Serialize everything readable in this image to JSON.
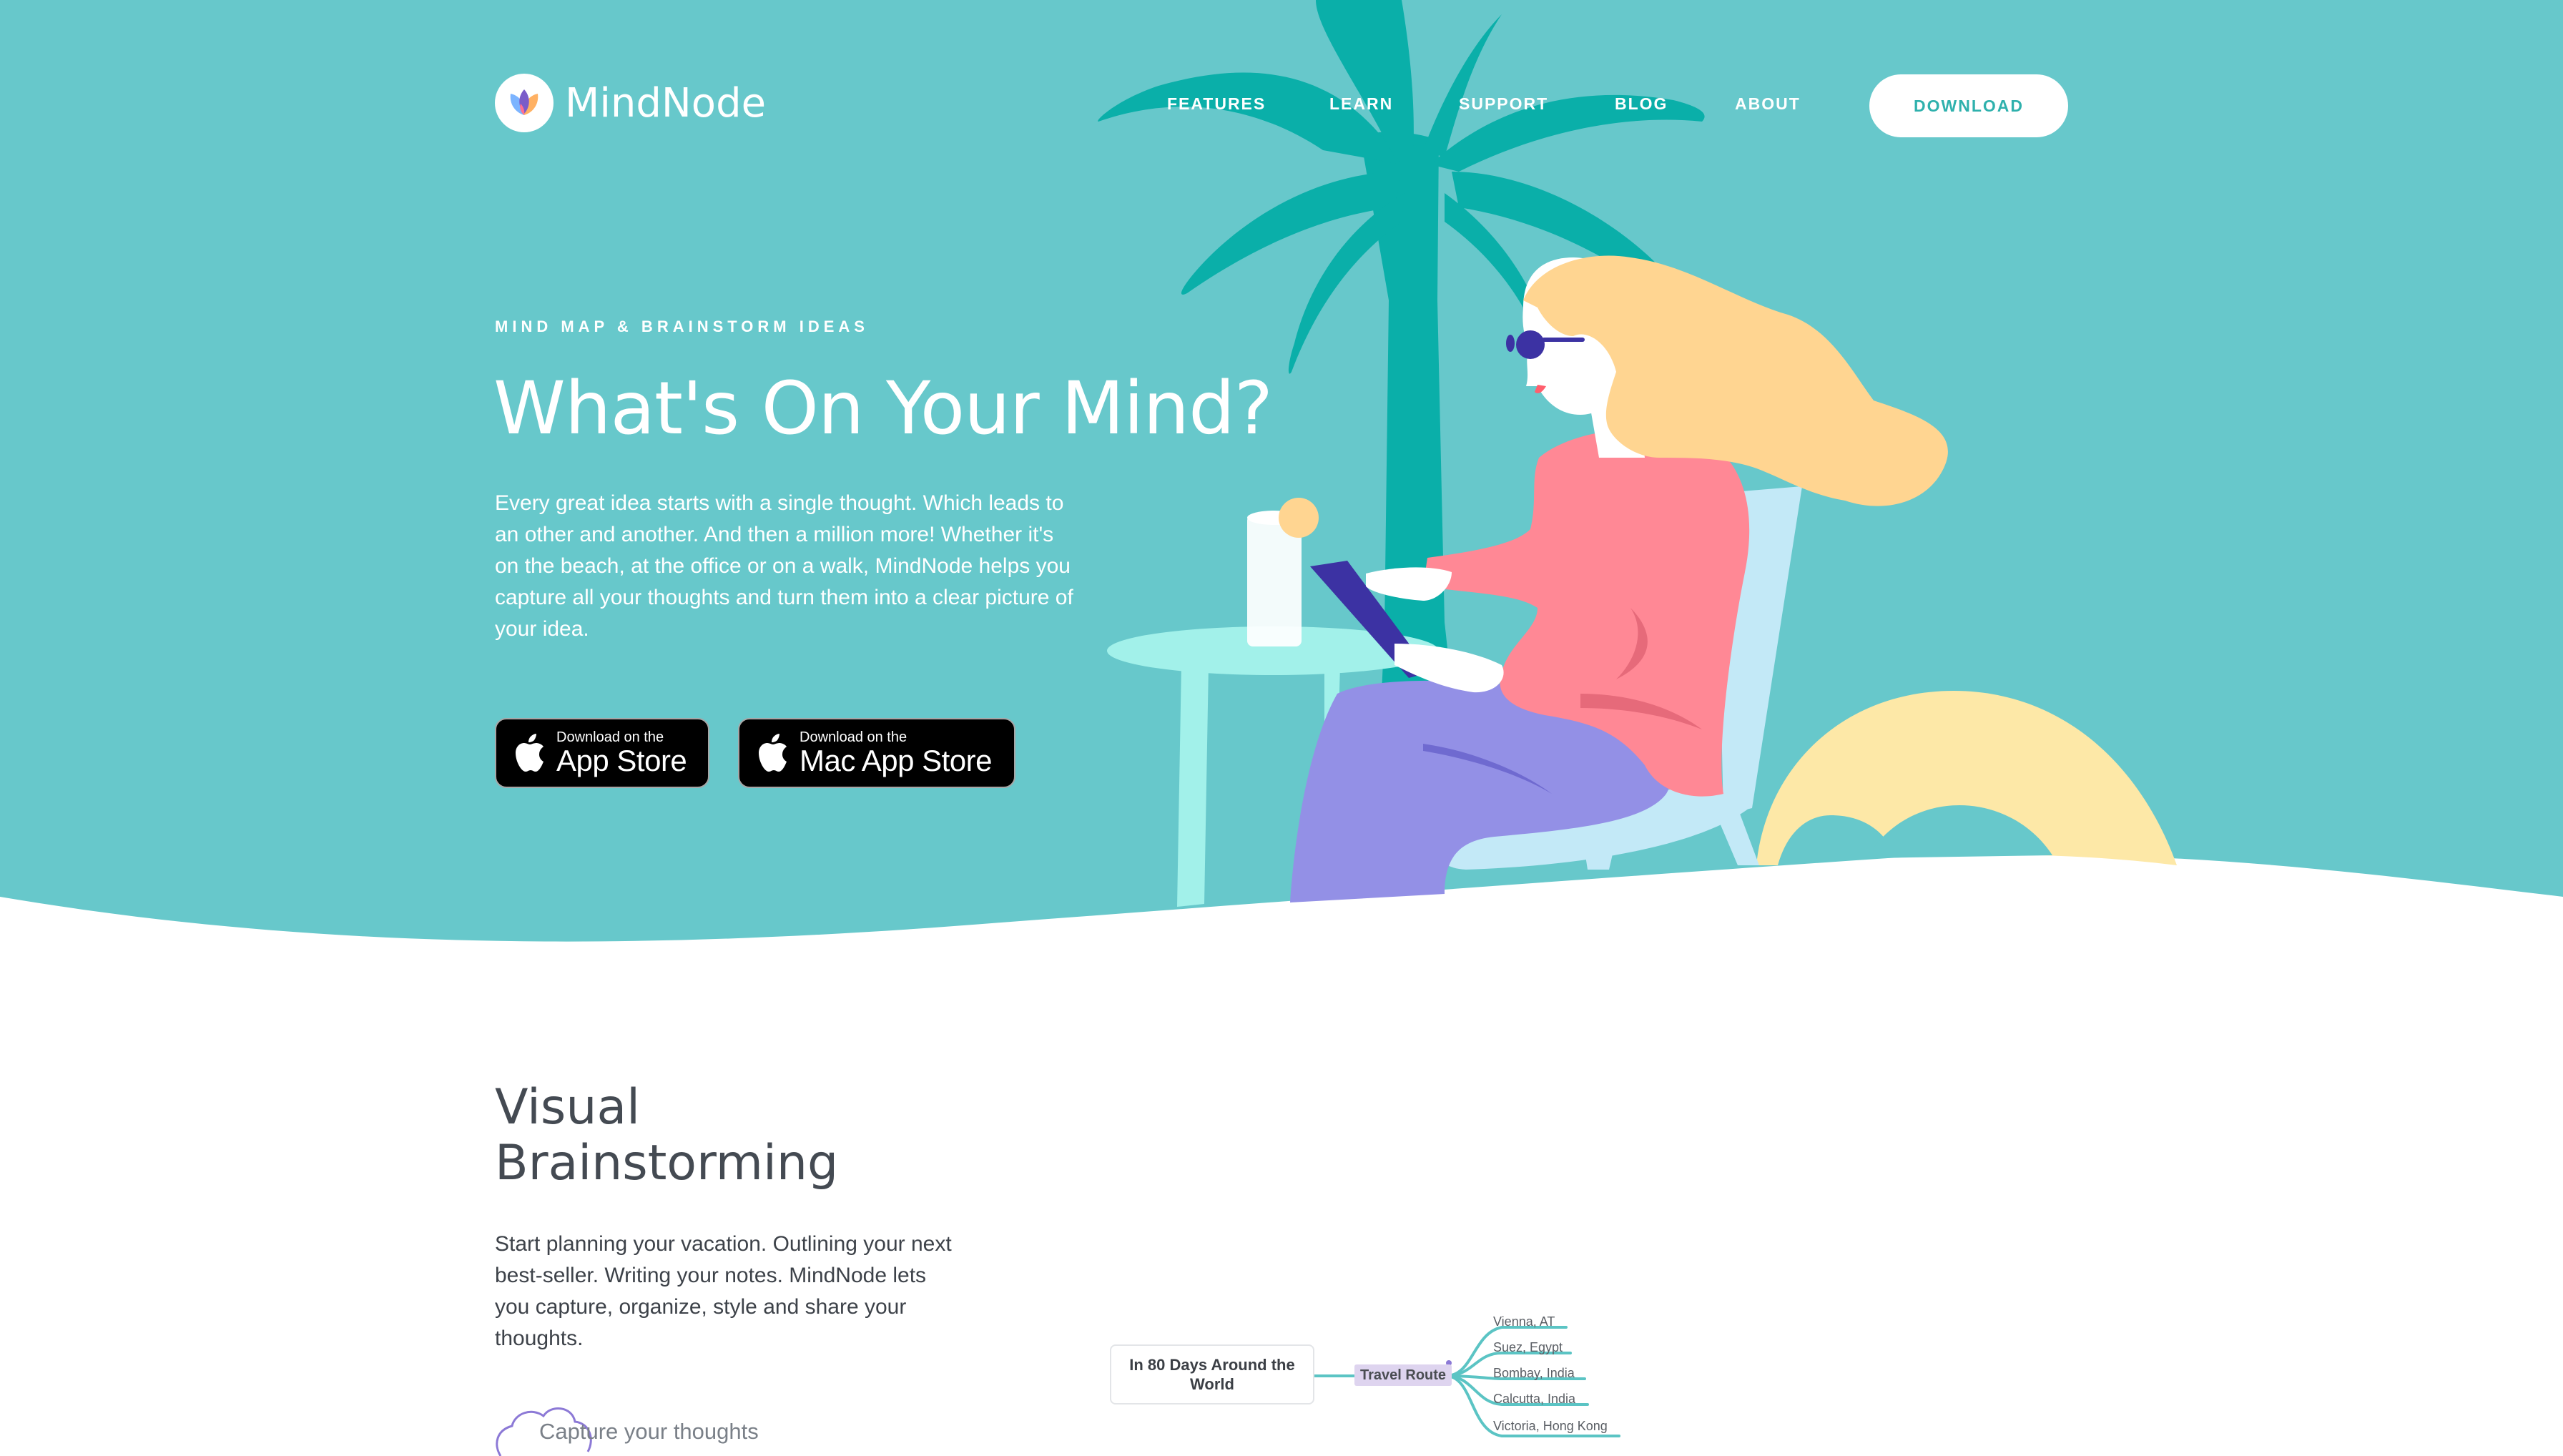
{
  "brand": {
    "name": "MindNode"
  },
  "nav": {
    "items": [
      {
        "label": "FEATURES"
      },
      {
        "label": "LEARN"
      },
      {
        "label": "SUPPORT"
      },
      {
        "label": "BLOG"
      },
      {
        "label": "ABOUT"
      }
    ],
    "download_label": "DOWNLOAD"
  },
  "hero": {
    "eyebrow": "MIND MAP & BRAINSTORM IDEAS",
    "title": "What's On Your Mind?",
    "text": "Every great idea starts with a single thought. Which leads to an other and another. And then a million more! Whether it's on the beach, at the office or on a walk, MindNode helps you capture all your thoughts and turn them into a clear picture of your idea.",
    "app_store": {
      "small": "Download on the",
      "big": "App Store"
    },
    "mac_app_store": {
      "small": "Download on the",
      "big": "Mac App Store"
    }
  },
  "section": {
    "title": "Visual Brainstorming",
    "text": "Start planning your vacation. Outlining your next best-seller. Writing your notes. MindNode lets you capture, organize, style and share your thoughts.",
    "feature_item": "Capture your thoughts"
  },
  "mindmap": {
    "root": "In 80 Days Around the World",
    "middle": "Travel Route",
    "leaves": [
      "Vienna, AT",
      "Suez, Egypt",
      "Bombay, India",
      "Calcutta, India",
      "Victoria, Hong Kong"
    ]
  },
  "colors": {
    "hero_bg": "#67c8cb",
    "accent": "#2fb1ad",
    "palm": "#0aafa9",
    "shirt": "#ff8895",
    "pants": "#9390e6",
    "hair": "#ffd591",
    "chair": "#c3e9f7",
    "table": "#a2f1ea",
    "float": "#fde8a7",
    "tablet": "#3c32a3"
  }
}
